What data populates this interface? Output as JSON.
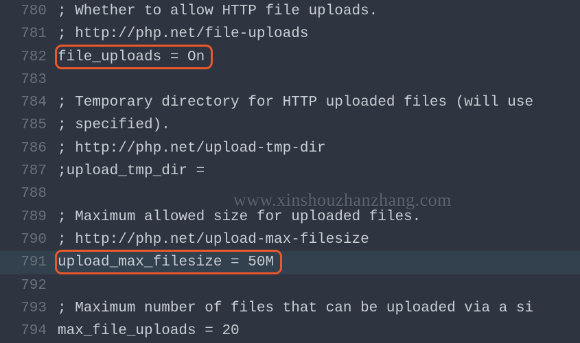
{
  "watermark": "www.xinshouzhanzhang.com",
  "highlight_color": "#e85a2b",
  "lines": [
    {
      "num": 780,
      "text": "; Whether to allow HTTP file uploads.",
      "highlighted": false
    },
    {
      "num": 781,
      "text": "; http://php.net/file-uploads",
      "highlighted": false
    },
    {
      "num": 782,
      "text": "file_uploads = On",
      "highlighted": true
    },
    {
      "num": 783,
      "text": "",
      "highlighted": false
    },
    {
      "num": 784,
      "text": "; Temporary directory for HTTP uploaded files (will use",
      "highlighted": false
    },
    {
      "num": 785,
      "text": "; specified).",
      "highlighted": false
    },
    {
      "num": 786,
      "text": "; http://php.net/upload-tmp-dir",
      "highlighted": false
    },
    {
      "num": 787,
      "text": ";upload_tmp_dir =",
      "highlighted": false
    },
    {
      "num": 788,
      "text": "",
      "highlighted": false
    },
    {
      "num": 789,
      "text": "; Maximum allowed size for uploaded files.",
      "highlighted": false
    },
    {
      "num": 790,
      "text": "; http://php.net/upload-max-filesize",
      "highlighted": false
    },
    {
      "num": 791,
      "text": "upload_max_filesize = 50M",
      "highlighted": true,
      "cursor": true
    },
    {
      "num": 792,
      "text": "",
      "highlighted": false
    },
    {
      "num": 793,
      "text": "; Maximum number of files that can be uploaded via a si",
      "highlighted": false
    },
    {
      "num": 794,
      "text": "max_file_uploads = 20",
      "highlighted": false
    }
  ]
}
